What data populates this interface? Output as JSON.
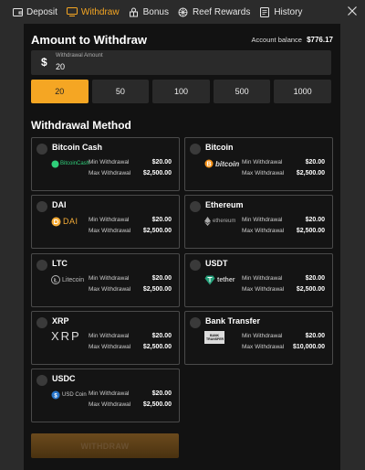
{
  "tabs": [
    {
      "label": "Deposit",
      "icon": "wallet-icon",
      "active": false
    },
    {
      "label": "Withdraw",
      "icon": "withdraw-icon",
      "active": true
    },
    {
      "label": "Bonus",
      "icon": "bonus-icon",
      "active": false
    },
    {
      "label": "Reef Rewards",
      "icon": "reef-rewards-icon",
      "active": false
    },
    {
      "label": "History",
      "icon": "history-icon",
      "active": false
    }
  ],
  "amount": {
    "title": "Amount to Withdraw",
    "balance_label": "Account balance",
    "balance_value": "$776.17",
    "currency_symbol": "$",
    "field_label": "Withdrawal Amount",
    "value": "20"
  },
  "presets": [
    "20",
    "50",
    "100",
    "500",
    "1000"
  ],
  "selected_preset": "20",
  "method": {
    "title": "Withdrawal Method",
    "min_label": "Min Withdrawal",
    "max_label": "Max Withdrawal"
  },
  "methods": [
    {
      "name": "Bitcoin Cash",
      "logo_text": "BitcoinCash",
      "min": "$20.00",
      "max": "$2,500.00"
    },
    {
      "name": "Bitcoin",
      "logo_text": "bitcoin",
      "min": "$20.00",
      "max": "$2,500.00"
    },
    {
      "name": "DAI",
      "logo_text": "DAI",
      "min": "$20.00",
      "max": "$2,500.00"
    },
    {
      "name": "Ethereum",
      "logo_text": "ethereum",
      "min": "$20.00",
      "max": "$2,500.00"
    },
    {
      "name": "LTC",
      "logo_text": "Litecoin",
      "min": "$20.00",
      "max": "$2,500.00"
    },
    {
      "name": "USDT",
      "logo_text": "tether",
      "min": "$20.00",
      "max": "$2,500.00"
    },
    {
      "name": "XRP",
      "logo_text": "XRP",
      "min": "$20.00",
      "max": "$2,500.00"
    },
    {
      "name": "Bank Transfer",
      "logo_text": "BANK TRANSFER",
      "min": "$20.00",
      "max": "$10,000.00"
    },
    {
      "name": "USDC",
      "logo_text": "USD Coin",
      "min": "$20.00",
      "max": "$2,500.00"
    }
  ],
  "withdraw_button": "WITHDRAW",
  "colors": {
    "accent": "#f5a623",
    "panel_bg": "#121212",
    "chrome_bg": "#2b2b2b"
  }
}
